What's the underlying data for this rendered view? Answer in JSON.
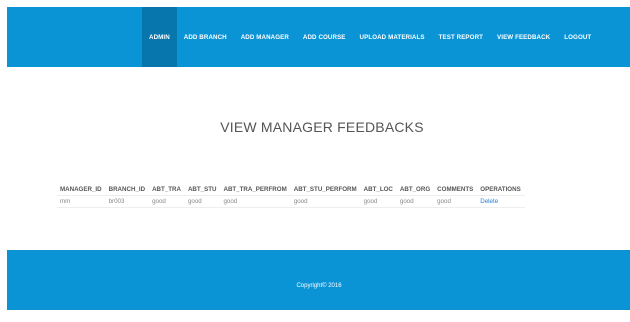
{
  "nav": {
    "items": [
      {
        "label": "ADMIN"
      },
      {
        "label": "ADD BRANCH"
      },
      {
        "label": "ADD MANAGER"
      },
      {
        "label": "ADD COURSE"
      },
      {
        "label": "UPLOAD MATERIALS"
      },
      {
        "label": "TEST REPORT"
      },
      {
        "label": "VIEW FEEDBACK"
      },
      {
        "label": "LOGOUT"
      }
    ]
  },
  "page": {
    "title": "VIEW MANAGER FEEDBACKS"
  },
  "table": {
    "headers": [
      "MANAGER_ID",
      "BRANCH_ID",
      "ABT_TRA",
      "ABT_STU",
      "ABT_TRA_PERFROM",
      "ABT_STU_PERFORM",
      "ABT_LOC",
      "ABT_ORG",
      "COMMENTS",
      "OPERATIONS"
    ],
    "rows": [
      [
        "mm",
        "br003",
        "good",
        "good",
        "good",
        "good",
        "good",
        "good",
        "good",
        "Delete"
      ]
    ]
  },
  "footer": {
    "copyright": "Copyright© 2016"
  }
}
